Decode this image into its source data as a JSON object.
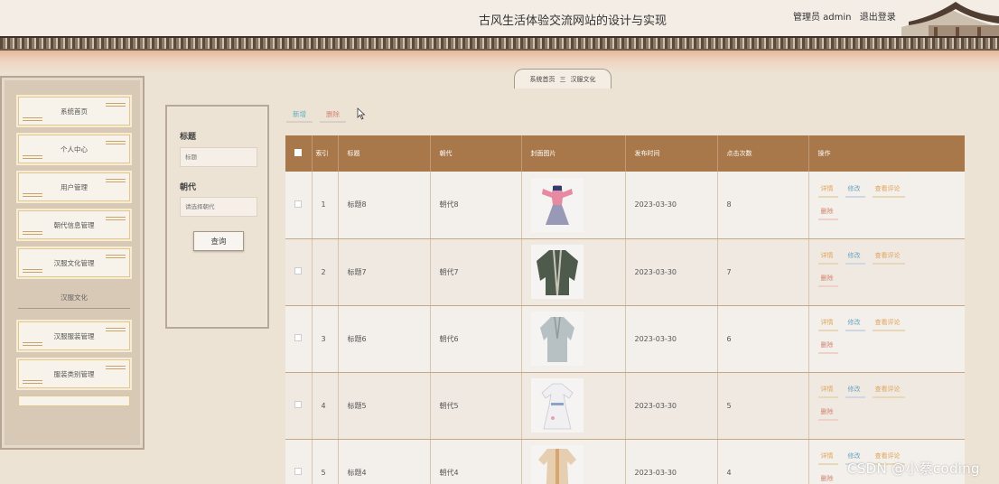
{
  "header": {
    "site_title": "古风生活体验交流网站的设计与实现",
    "user_role": "管理员 admin",
    "logout_label": "退出登录"
  },
  "breadcrumb": {
    "home": "系统首页",
    "separator": "三",
    "current": "汉服文化"
  },
  "sidebar": {
    "items": [
      {
        "label": "系统首页"
      },
      {
        "label": "个人中心"
      },
      {
        "label": "用户管理"
      },
      {
        "label": "朝代信息管理"
      },
      {
        "label": "汉服文化管理"
      }
    ],
    "section_label": "汉服文化",
    "sub_items": [
      {
        "label": "汉服服装管理"
      },
      {
        "label": "服装类别管理"
      }
    ]
  },
  "search": {
    "title_label": "标题",
    "title_placeholder": "标题",
    "dynasty_label": "朝代",
    "dynasty_placeholder": "请选择朝代",
    "query_label": "查询"
  },
  "toolbar": {
    "add_label": "新增",
    "delete_label": "删除"
  },
  "table": {
    "headers": {
      "index": "索引",
      "title": "标题",
      "dynasty": "朝代",
      "cover": "封面图片",
      "date": "发布时间",
      "clicks": "点击次数",
      "actions": "操作"
    },
    "action_labels": {
      "detail": "详情",
      "edit": "修改",
      "review": "查看评论",
      "delete": "删除"
    },
    "rows": [
      {
        "index": "1",
        "title": "标题8",
        "dynasty": "朝代8",
        "date": "2023-03-30",
        "clicks": "8",
        "image": "pink-hanfu-image"
      },
      {
        "index": "2",
        "title": "标题7",
        "dynasty": "朝代7",
        "date": "2023-03-30",
        "clicks": "7",
        "image": "dark-robe-image"
      },
      {
        "index": "3",
        "title": "标题6",
        "dynasty": "朝代6",
        "date": "2023-03-30",
        "clicks": "6",
        "image": "grey-robe-image"
      },
      {
        "index": "4",
        "title": "标题5",
        "dynasty": "朝代5",
        "date": "2023-03-30",
        "clicks": "5",
        "image": "white-hanfu-image"
      },
      {
        "index": "5",
        "title": "标题4",
        "dynasty": "朝代4",
        "date": "2023-03-30",
        "clicks": "4",
        "image": "beige-hanfu-image"
      }
    ]
  },
  "watermark": "CSDN @小蔡coding",
  "colors": {
    "table_header": "#a8774a",
    "accent_gold": "#e2a35b",
    "accent_blue": "#6aa6c4",
    "accent_red": "#d4836f",
    "background": "#ede3d5"
  }
}
